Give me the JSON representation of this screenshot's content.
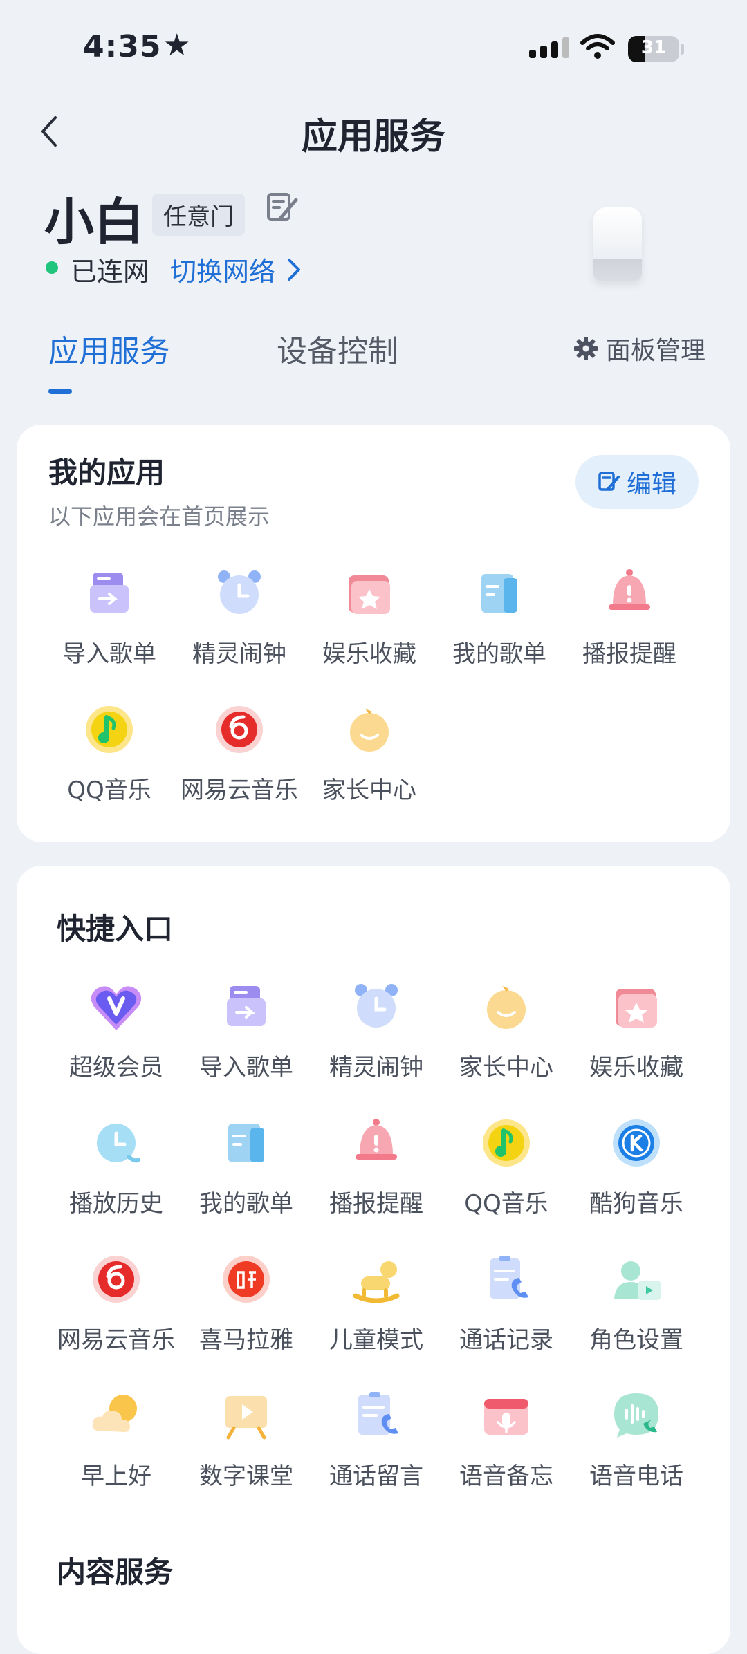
{
  "status_bar": {
    "time": "4:35",
    "battery": "31"
  },
  "nav": {
    "title": "应用服务"
  },
  "device": {
    "name": "小白",
    "tag": "任意门",
    "status": "已连网",
    "switch_network": "切换网络"
  },
  "tabs": [
    {
      "label": "应用服务",
      "active": true
    },
    {
      "label": "设备控制",
      "active": false
    }
  ],
  "panel_manage": "面板管理",
  "my_apps": {
    "title": "我的应用",
    "subtitle": "以下应用会在首页展示",
    "edit_label": "编辑",
    "items": [
      {
        "label": "导入歌单",
        "icon": "import-playlist-icon"
      },
      {
        "label": "精灵闹钟",
        "icon": "alarm-clock-icon"
      },
      {
        "label": "娱乐收藏",
        "icon": "favorites-folder-icon"
      },
      {
        "label": "我的歌单",
        "icon": "playlist-icon"
      },
      {
        "label": "播报提醒",
        "icon": "bell-icon"
      },
      {
        "label": "QQ音乐",
        "icon": "qq-music-icon"
      },
      {
        "label": "网易云音乐",
        "icon": "netease-music-icon"
      },
      {
        "label": "家长中心",
        "icon": "parent-center-icon"
      }
    ]
  },
  "quick_entry": {
    "title": "快捷入口",
    "items": [
      {
        "label": "超级会员",
        "icon": "vip-heart-icon"
      },
      {
        "label": "导入歌单",
        "icon": "import-playlist-icon"
      },
      {
        "label": "精灵闹钟",
        "icon": "alarm-clock-icon"
      },
      {
        "label": "家长中心",
        "icon": "parent-center-icon"
      },
      {
        "label": "娱乐收藏",
        "icon": "favorites-folder-icon"
      },
      {
        "label": "播放历史",
        "icon": "play-history-icon"
      },
      {
        "label": "我的歌单",
        "icon": "playlist-icon"
      },
      {
        "label": "播报提醒",
        "icon": "bell-icon"
      },
      {
        "label": "QQ音乐",
        "icon": "qq-music-icon"
      },
      {
        "label": "酷狗音乐",
        "icon": "kugou-music-icon"
      },
      {
        "label": "网易云音乐",
        "icon": "netease-music-icon"
      },
      {
        "label": "喜马拉雅",
        "icon": "ximalaya-icon"
      },
      {
        "label": "儿童模式",
        "icon": "rocking-horse-icon"
      },
      {
        "label": "通话记录",
        "icon": "call-log-icon"
      },
      {
        "label": "角色设置",
        "icon": "role-settings-icon"
      },
      {
        "label": "早上好",
        "icon": "sun-cloud-icon"
      },
      {
        "label": "数字课堂",
        "icon": "digital-classroom-icon"
      },
      {
        "label": "通话留言",
        "icon": "call-message-icon"
      },
      {
        "label": "语音备忘",
        "icon": "voice-memo-icon"
      },
      {
        "label": "语音电话",
        "icon": "voice-call-icon"
      }
    ]
  },
  "content_service": {
    "title": "内容服务"
  },
  "colors": {
    "accent": "#1f6fd6",
    "online": "#22c57d",
    "background": "#eef1f6"
  }
}
